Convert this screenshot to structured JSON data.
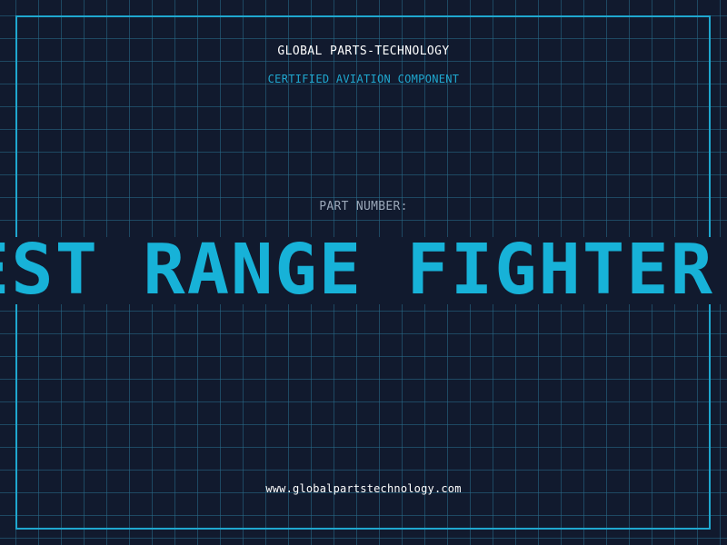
{
  "header": {
    "company": "GLOBAL PARTS-TECHNOLOGY",
    "subtitle": "CERTIFIED AVIATION COMPONENT"
  },
  "part": {
    "label": "PART NUMBER:",
    "value": "GEST RANGE FIGHTER"
  },
  "footer": {
    "url": "www.globalpartstechnology.com"
  },
  "colors": {
    "background": "#111a2e",
    "accent": "#17b2d8",
    "grid": "#286e8c",
    "label": "#9aa7b8"
  }
}
